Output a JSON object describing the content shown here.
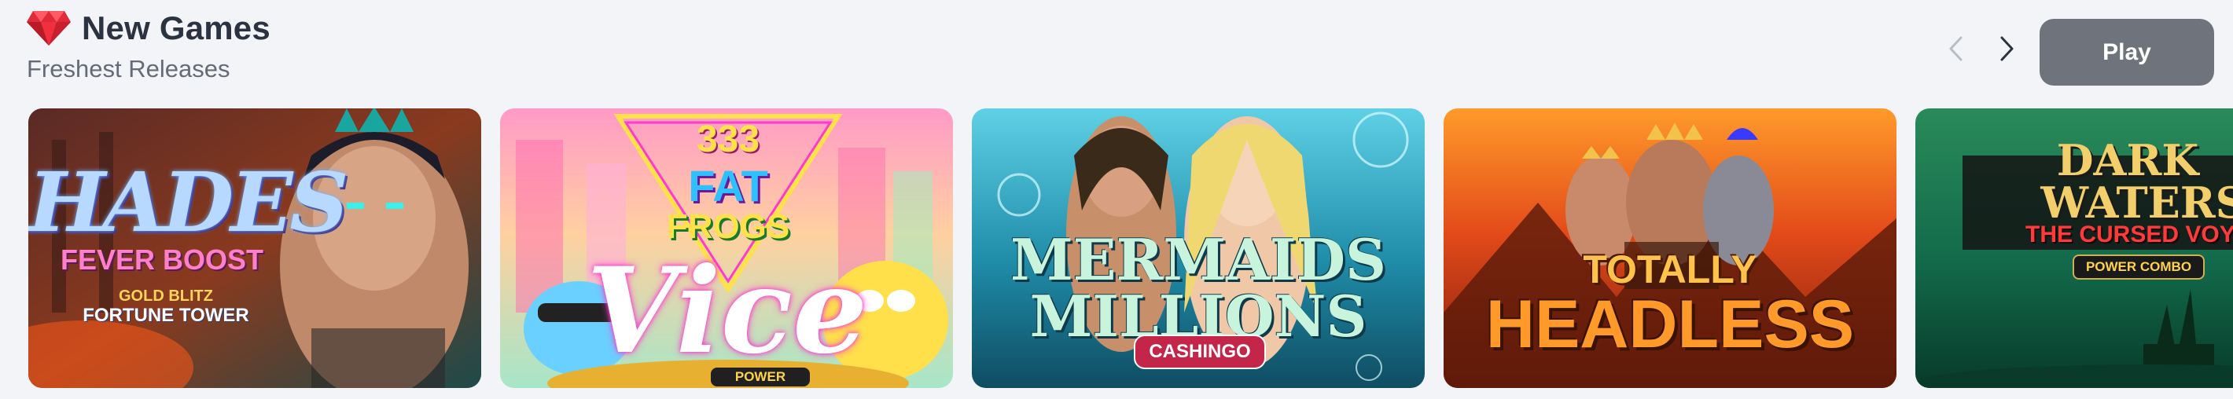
{
  "header": {
    "icon": "diamond-icon",
    "title": "New Games",
    "subtitle": "Freshest Releases"
  },
  "nav": {
    "prev_icon": "chevron-left-icon",
    "next_icon": "chevron-right-icon"
  },
  "play_button": {
    "label": "Play"
  },
  "games": [
    {
      "title": "HADES",
      "subtitle": "FEVER BOOST",
      "tagline_top": "GOLD BLITZ",
      "tagline_bottom": "FORTUNE TOWER"
    },
    {
      "title_top": "333",
      "title_mid": "FAT",
      "title_low": "FROGS",
      "title": "Vice",
      "badge": "POWER COMBO"
    },
    {
      "title_line1": "MERMAIDS",
      "title_line2": "MILLIONS",
      "badge": "CASHINGO"
    },
    {
      "title_line1": "TOTALLY",
      "title_line2": "HEADLESS"
    },
    {
      "title_line1": "DARK",
      "title_line2": "WATERS",
      "subtitle": "THE CURSED VOY",
      "badge": "POWER COMBO"
    }
  ],
  "colors": {
    "background": "#f3f4f7",
    "title": "#2b3340",
    "subtitle": "#646b77",
    "play_button": "#6f747c",
    "gem": "#e02a3a"
  }
}
